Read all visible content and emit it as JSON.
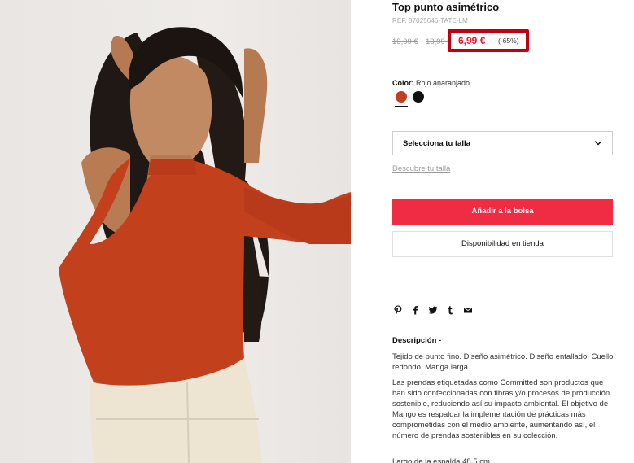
{
  "product": {
    "title": "Top punto asimétrico",
    "ref": "REF. 87025646-TATE-LM",
    "image_alt": "model-wearing-asymmetric-orange-top"
  },
  "pricing": {
    "original_price": "19,99 €",
    "previous_price": "13,99 €",
    "sale_price": "6,99 €",
    "discount": "(-65%)",
    "highlight_color": "#c00012",
    "sale_color": "#e7192f"
  },
  "color": {
    "label": "Color:",
    "selected_value": "Rojo anaranjado",
    "swatches": [
      {
        "name": "Rojo anaranjado",
        "hex": "#c2401f",
        "selected": true
      },
      {
        "name": "Negro",
        "hex": "#111111",
        "selected": false
      }
    ]
  },
  "size": {
    "select_label": "Selecciona tu talla",
    "guide_link": "Descubre tu talla"
  },
  "actions": {
    "add_to_bag": "Añadir a la bolsa",
    "store_availability": "Disponibilidad en tienda",
    "accent_color": "#ef2c43"
  },
  "share": {
    "icons": [
      "pinterest-icon",
      "facebook-icon",
      "twitter-icon",
      "tumblr-icon",
      "email-icon"
    ]
  },
  "description": {
    "heading": "Descripción -",
    "paragraph_1": "Tejido de punto fino. Diseño asimétrico. Diseño entallado. Cuello redondo. Manga larga.",
    "paragraph_2": "Las prendas etiquetadas como Committed son productos que han sido confeccionadas con fibras y/o procesos de producción sostenible, reduciendo así su impacto ambiental. El objetivo de Mango es respaldar la implementación de prácticas más comprometidas con el medio ambiente, aumentando así, el número de prendas sostenibles en su colección.",
    "paragraph_3": "Largo de la espalda 48,5 cm."
  }
}
